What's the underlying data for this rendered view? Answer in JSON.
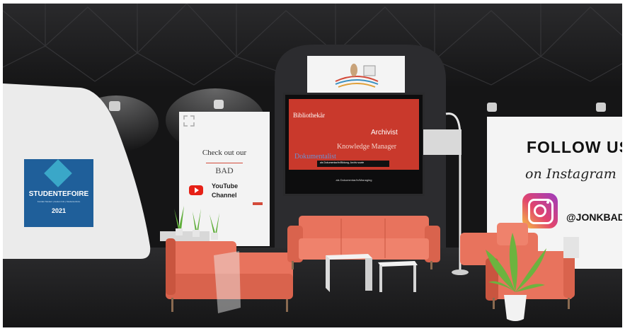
{
  "left_banner": {
    "logo_lines": [
      "STUDENTENFOIRE",
      "Kontakt Student | Auslan Info | Studentenfoire",
      "2021"
    ],
    "name": "STUDENTEFOIRE",
    "tagline": "Kontakt Student | Auslan Info | Studentenfoire",
    "year": "2021",
    "panel_color": "#1f5f9a",
    "accent_color": "#3aa7c8"
  },
  "youtube_board": {
    "line1": "Check out our",
    "brand": "BAD",
    "line2": "YouTube",
    "line3": "Channel",
    "icon": "youtube-icon"
  },
  "screen": {
    "word1": "Bibliothekär",
    "word2": "Archivist",
    "word3": "Knowledge Manager",
    "word4": "Dokumentalist",
    "caption1": "als Dokumentar/in/Bildung, Archiv sowie",
    "caption2": "als Dokumentar/in/Managing",
    "bg_color": "#c9392c"
  },
  "instagram_board": {
    "title": "FOLLOW US",
    "subtitle": "on Instagram",
    "handle": "@JONKBAD",
    "icon": "instagram-icon"
  },
  "colors": {
    "sofa": "#e8735d",
    "sofa_dark": "#c9553f",
    "floor": "#202022",
    "wall": "#141415"
  }
}
